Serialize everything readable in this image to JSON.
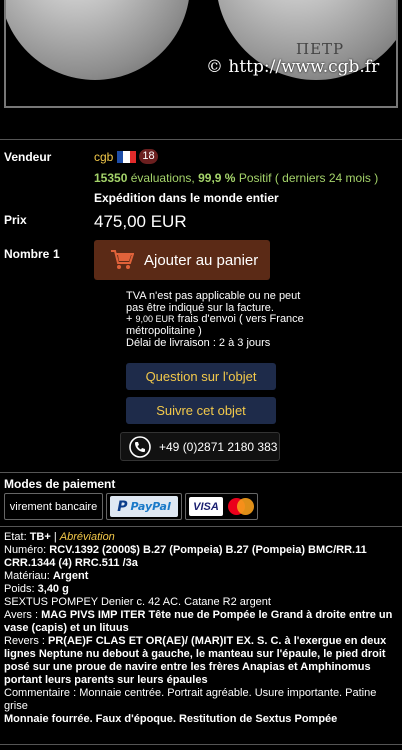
{
  "image": {
    "watermark": "© http://www.cgb.fr",
    "coin_legend": "ΠΕΤΡ"
  },
  "seller": {
    "label": "Vendeur",
    "name": "cgb",
    "flag_colors": [
      "#1f4ea8",
      "#ffffff",
      "#e12b2b"
    ],
    "badge": "18",
    "eval_count": "15350",
    "eval_word": "évaluations,",
    "positive_pct": "99,9 %",
    "positive_word": "Positif",
    "period": "( derniers 24 mois )",
    "shipping": "Expédition dans le monde entier"
  },
  "price": {
    "label": "Prix",
    "value": "475,00 EUR"
  },
  "quantity": {
    "label": "Nombre",
    "value": "1"
  },
  "cart": {
    "label": "Ajouter au panier"
  },
  "tax": {
    "line1": "TVA n'est pas applicable ou ne peut",
    "line2": "pas être indiqué sur la facture.",
    "plus": "+",
    "shipping_amount": "9,00 EUR",
    "shipping_text": "frais d'envoi ( vers France",
    "shipping_text2": "métropolitaine )",
    "delivery": "Délai de livraison : 2 à 3 jours"
  },
  "actions": {
    "question": "Question sur l'objet",
    "follow": "Suivre cet objet"
  },
  "phone": {
    "number": "+49 (0)2871 2180 383"
  },
  "payment": {
    "heading": "Modes de paiement",
    "bank": "virement bancaire",
    "paypal_mark": "P",
    "paypal_word": "PayPal",
    "visa": "VISA"
  },
  "details": {
    "etat_label": "Etat:",
    "etat_value": "TB+",
    "etat_sep": "|",
    "etat_abbr": "Abréviation",
    "numero_label": "Numéro:",
    "numero_value": "RCV.1392 (2000$) B.27 (Pompeia) B.27 (Pompeia) BMC/RR.11 CRR.1344 (4) RRC.511 /3a",
    "materiau_label": "Matériau:",
    "materiau_value": "Argent",
    "poids_label": "Poids:",
    "poids_value": "3,40 g",
    "title": "SEXTUS POMPEY Denier c. 42 AC. Catane R2 argent",
    "avers_label": "Avers :",
    "avers_value": "MAG PIVS IMP ITER Tête nue de Pompée le Grand à droite entre un vase (capis) et un lituus",
    "revers_label": "Revers :",
    "revers_value": "PR(AE)F CLAS ET OR(AE)/ (MAR)IT EX. S. C. à l'exergue en deux lignes Neptune nu debout à gauche, le manteau sur l'épaule, le pied droit posé sur une proue de navire entre les frères Anapias et Amphinomus portant leurs parents sur leurs épaules",
    "commentaire_label": "Commentaire :",
    "commentaire_value": "Monnaie centrée. Portrait agréable. Usure importante. Patine grise",
    "note": "Monnaie fourrée. Faux d'époque. Restitution de Sextus Pompée"
  }
}
